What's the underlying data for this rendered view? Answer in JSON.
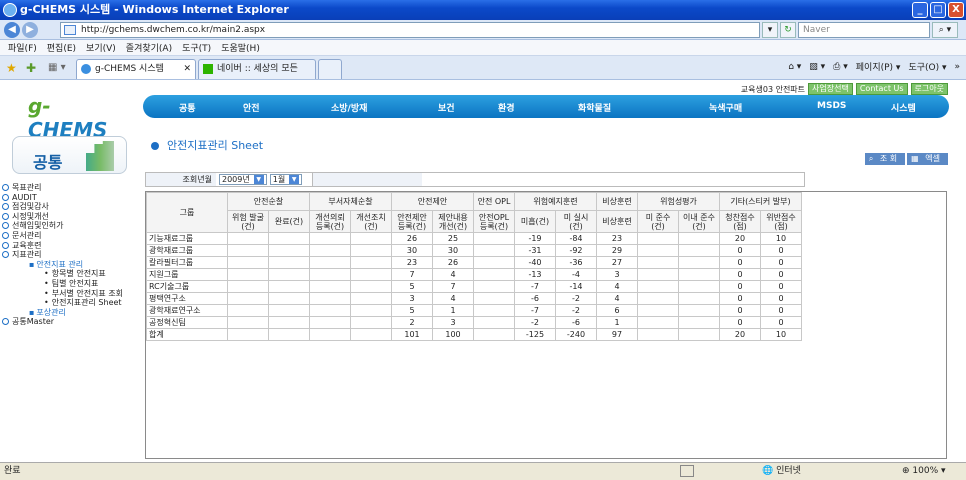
{
  "window": {
    "title": "g-CHEMS 시스템 - Windows Internet Explorer",
    "controls": [
      "_",
      "□",
      "X"
    ]
  },
  "address": {
    "url": "http://gchems.dwchem.co.kr/main2.aspx",
    "search_placeholder": "Naver"
  },
  "menu_bar": [
    "파일(F)",
    "편집(E)",
    "보기(V)",
    "즐겨찾기(A)",
    "도구(T)",
    "도움말(H)"
  ],
  "tabs": [
    {
      "label": "g-CHEMS 시스템",
      "active": true
    },
    {
      "label": "네이버 :: 세상의 모든 지...",
      "active": false
    }
  ],
  "ie_commands": [
    "페이지(P) ▾",
    "도구(O) ▾"
  ],
  "site": {
    "logo_main": "CHEMS",
    "logo_g": "g-",
    "user": "교육생03 안전파트",
    "util_buttons": [
      "사업장선택",
      "Contact Us",
      "로그아웃"
    ]
  },
  "gnb": [
    "공통",
    "안전",
    "소방/방재",
    "보건",
    "환경",
    "화학물질",
    "녹색구매",
    "MSDS",
    "시스템"
  ],
  "sidebar": {
    "title": "공통",
    "items": [
      {
        "label": "목표관리",
        "level": 1
      },
      {
        "label": "AUDIT",
        "level": 1
      },
      {
        "label": "점검및감사",
        "level": 1
      },
      {
        "label": "시정및개선",
        "level": 1
      },
      {
        "label": "선해임및인허가",
        "level": 1
      },
      {
        "label": "문서관리",
        "level": 1
      },
      {
        "label": "교육훈련",
        "level": 1
      },
      {
        "label": "지표관리",
        "level": 1
      },
      {
        "label": "안전지표 관리",
        "level": 2
      },
      {
        "label": "항목별 안전지표",
        "level": 3
      },
      {
        "label": "팀별 안전지표",
        "level": 3
      },
      {
        "label": "부서별 안전지표 조회",
        "level": 3
      },
      {
        "label": "안전지표관리 Sheet",
        "level": 3
      },
      {
        "label": "포상관리",
        "level": 2
      },
      {
        "label": "공통Master",
        "level": 1
      }
    ]
  },
  "page": {
    "title": "안전지표관리 Sheet",
    "buttons": [
      "조 회",
      "엑셀"
    ],
    "cond_label": "조회년월",
    "year": "2009년",
    "month": "1월"
  },
  "table": {
    "group_headers": [
      {
        "label": "그룹",
        "colspan": 1
      },
      {
        "label": "안전순찰",
        "colspan": 2
      },
      {
        "label": "부서자체순찰",
        "colspan": 2
      },
      {
        "label": "안전제안",
        "colspan": 2
      },
      {
        "label": "안전 OPL",
        "colspan": 1
      },
      {
        "label": "위험예지훈련",
        "colspan": 2
      },
      {
        "label": "비상훈련",
        "colspan": 1
      },
      {
        "label": "위험성평가",
        "colspan": 2
      },
      {
        "label": "기타(스티커 발부)",
        "colspan": 2
      }
    ],
    "sub_headers": [
      "위험 발굴\n(건)",
      "완료(건)",
      "개선의뢰\n등록(건)",
      "개선조치\n(건)",
      "안전제안\n등록(건)",
      "제안내용\n개선(건)",
      "안전OPL\n등록(건)",
      "미흡(건)",
      "미 실시\n(건)",
      "비상훈련",
      "미 준수\n(건)",
      "이내 준수\n(건)",
      "청찬점수\n(점)",
      "위반점수\n(점)"
    ],
    "rows": [
      [
        "기능재료그룹",
        "",
        "",
        "",
        "",
        "26",
        "25",
        "",
        "-19",
        "-84",
        "23",
        "",
        "",
        "20",
        "10"
      ],
      [
        "광학재료그룹",
        "",
        "",
        "",
        "",
        "30",
        "30",
        "",
        "-31",
        "-92",
        "29",
        "",
        "",
        "0",
        "0"
      ],
      [
        "칼라필터그룹",
        "",
        "",
        "",
        "",
        "23",
        "26",
        "",
        "-40",
        "-36",
        "27",
        "",
        "",
        "0",
        "0"
      ],
      [
        "지원그룹",
        "",
        "",
        "",
        "",
        "7",
        "4",
        "",
        "-13",
        "-4",
        "3",
        "",
        "",
        "0",
        "0"
      ],
      [
        "RC기술그룹",
        "",
        "",
        "",
        "",
        "5",
        "7",
        "",
        "-7",
        "-14",
        "4",
        "",
        "",
        "0",
        "0"
      ],
      [
        "평택연구소",
        "",
        "",
        "",
        "",
        "3",
        "4",
        "",
        "-6",
        "-2",
        "4",
        "",
        "",
        "0",
        "0"
      ],
      [
        "광학재료연구소",
        "",
        "",
        "",
        "",
        "5",
        "1",
        "",
        "-7",
        "-2",
        "6",
        "",
        "",
        "0",
        "0"
      ],
      [
        "공정혁신팀",
        "",
        "",
        "",
        "",
        "2",
        "3",
        "",
        "-2",
        "-6",
        "1",
        "",
        "",
        "0",
        "0"
      ],
      [
        "합계",
        "",
        "",
        "",
        "",
        "101",
        "100",
        "",
        "-125",
        "-240",
        "97",
        "",
        "",
        "20",
        "10"
      ]
    ]
  },
  "status": {
    "left": "완료",
    "zone": "인터넷",
    "zoom": "100%"
  }
}
